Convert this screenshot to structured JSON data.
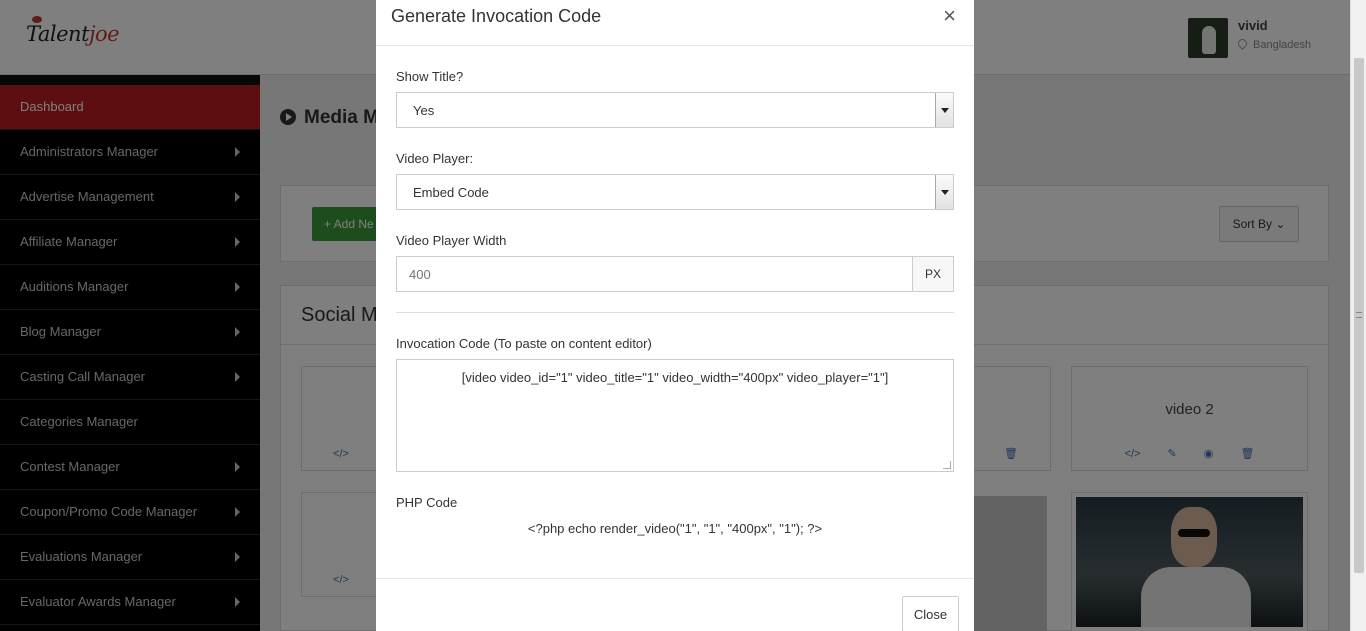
{
  "brand": {
    "logo_text_main": "Talent",
    "logo_text_accent": "joe"
  },
  "user": {
    "name": "vivid",
    "location": "Bangladesh"
  },
  "sidebar": {
    "items": [
      {
        "label": "Dashboard",
        "active": true
      },
      {
        "label": "Administrators Manager"
      },
      {
        "label": "Advertise Management"
      },
      {
        "label": "Affiliate Manager"
      },
      {
        "label": "Auditions Manager"
      },
      {
        "label": "Blog Manager"
      },
      {
        "label": "Casting Call Manager"
      },
      {
        "label": "Categories Manager"
      },
      {
        "label": "Contest Manager"
      },
      {
        "label": "Coupon/Promo Code Manager"
      },
      {
        "label": "Evaluations Manager"
      },
      {
        "label": "Evaluator Awards Manager"
      }
    ]
  },
  "main": {
    "title": "Media M",
    "add_button": "+ Add Ne",
    "sort_button": "Sort By",
    "section_title": "Social M",
    "cards": [
      {
        "title": "video 2"
      }
    ]
  },
  "modal": {
    "title": "Generate Invocation Code",
    "close_icon": "×",
    "show_title": {
      "label": "Show Title?",
      "value": "Yes"
    },
    "video_player": {
      "label": "Video Player:",
      "value": "Embed Code"
    },
    "width": {
      "label": "Video Player Width",
      "placeholder": "400",
      "unit": "PX"
    },
    "invocation": {
      "label": "Invocation Code (To paste on content editor)",
      "code": "[video video_id=\"1\" video_title=\"1\" video_width=\"400px\" video_player=\"1\"]"
    },
    "php": {
      "label": "PHP Code",
      "code": "<?php echo render_video(\"1\", \"1\", \"400px\", \"1\"); ?>"
    },
    "close_button": "Close"
  },
  "colors": {
    "sidebar_active": "#b81c22",
    "add_button": "#3a9b3a",
    "icon_blue": "#3d6fb6"
  }
}
